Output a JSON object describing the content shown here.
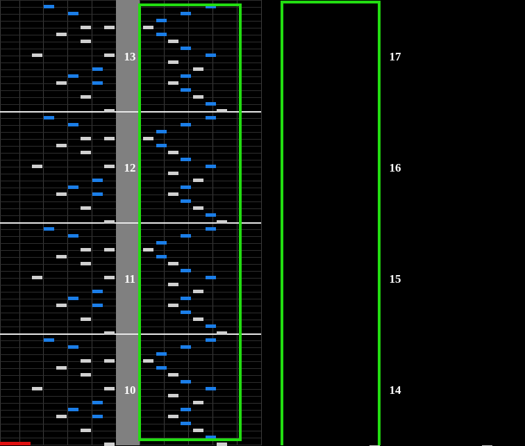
{
  "title": "",
  "colors": {
    "white_note": "#d0d0d0",
    "blue_note": "#1b7ee8",
    "highlight": "#22dd11",
    "measure_strip": "#808080",
    "bar_line": "#e8e8e8",
    "position_marker": "#e01010"
  },
  "left_panel": {
    "measures": [
      {
        "number": "13"
      },
      {
        "number": "12"
      },
      {
        "number": "11"
      },
      {
        "number": "10"
      }
    ]
  },
  "right_panel": {
    "measures": [
      {
        "number": "17"
      },
      {
        "number": "16"
      },
      {
        "number": "15"
      },
      {
        "number": "14"
      }
    ]
  }
}
